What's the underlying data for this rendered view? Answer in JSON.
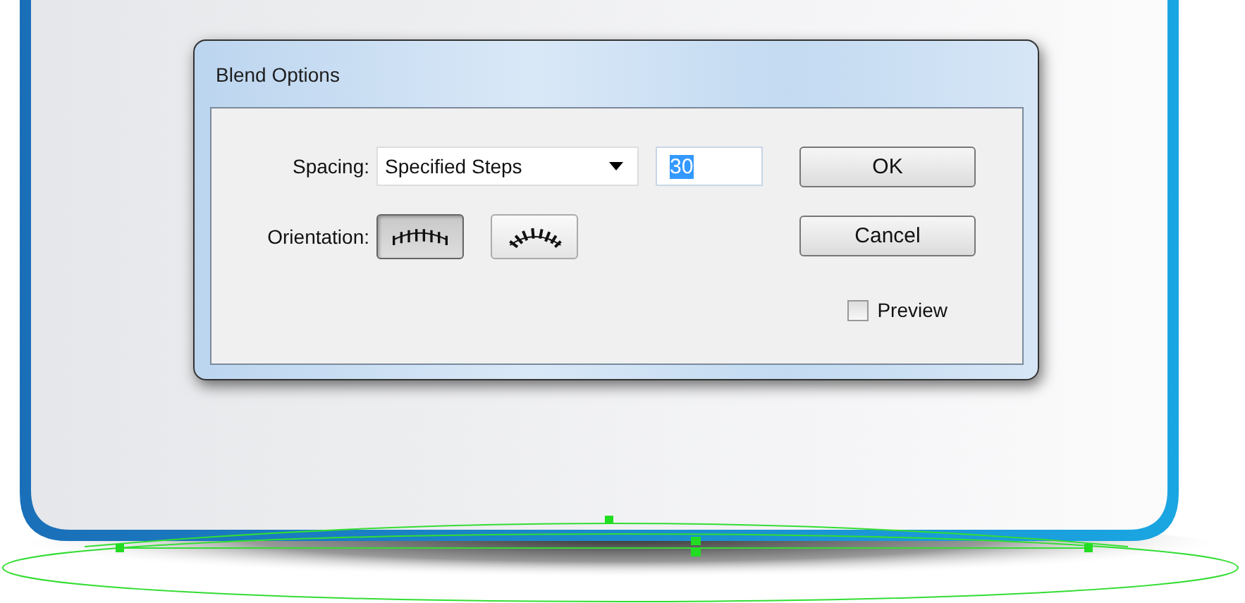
{
  "dialog": {
    "title": "Blend Options",
    "spacing": {
      "label": "Spacing:",
      "value": "Specified Steps",
      "steps": "30",
      "steps_selected": true
    },
    "orientation": {
      "label": "Orientation:",
      "options": [
        {
          "kind": "page",
          "selected": true
        },
        {
          "kind": "path",
          "selected": false
        }
      ]
    },
    "buttons": [
      "OK",
      "Cancel"
    ],
    "preview": {
      "label": "Preview",
      "checked": false
    }
  }
}
